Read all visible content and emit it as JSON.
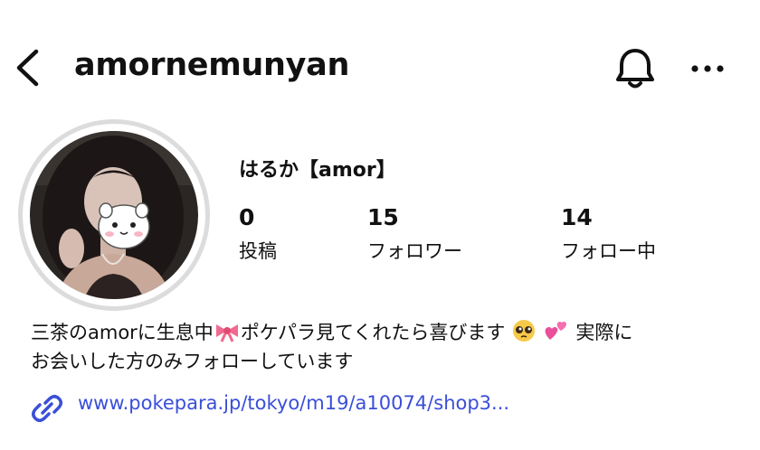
{
  "header": {
    "username": "amornemunyan",
    "icons": [
      "chevron-left-icon",
      "bell-icon",
      "more-horizontal-icon"
    ]
  },
  "profile": {
    "display_name": "はるか【amor】",
    "stats": [
      {
        "value": "0",
        "label": "投稿"
      },
      {
        "value": "15",
        "label": "フォロワー"
      },
      {
        "value": "14",
        "label": "フォロー中"
      }
    ],
    "bio": {
      "line1_a": "三茶のamorに生息中",
      "line1_b": "ポケパラ見てくれたら喜びます",
      "line1_c": "実際に",
      "line2": "お会いした方のみフォローしています"
    },
    "link": "www.pokepara.jp/tokyo/m19/a10074/shop3..."
  },
  "colors": {
    "link": "#3a4fd8",
    "ring": "#dcdcdc"
  }
}
